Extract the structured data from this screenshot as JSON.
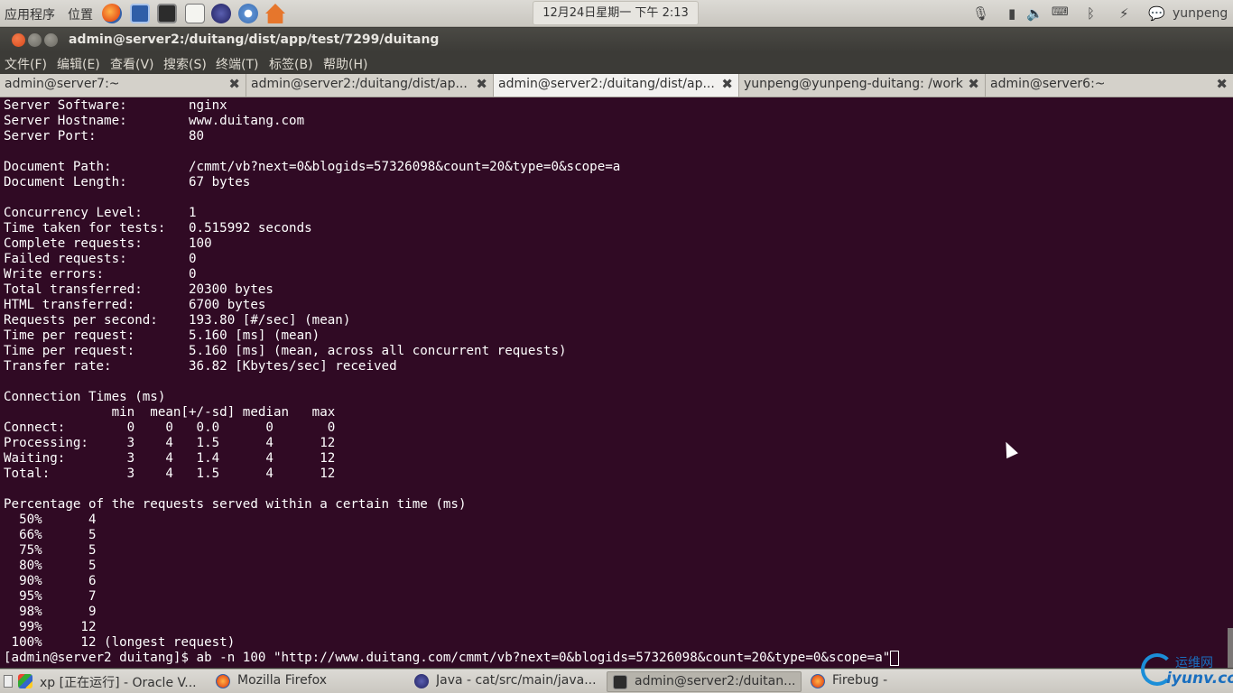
{
  "top_panel": {
    "menus": [
      "应用程序",
      "位置"
    ],
    "launchers": [
      "firefox-icon",
      "system-monitor-icon",
      "terminal-icon",
      "text-editor-icon",
      "eclipse-icon",
      "chromium-icon",
      "home-icon"
    ],
    "clock": "12月24日星期一 下午 2:13",
    "user": "yunpeng"
  },
  "window": {
    "title": "admin@server2:/duitang/dist/app/test/7299/duitang"
  },
  "menubar": [
    "文件(F)",
    "编辑(E)",
    "查看(V)",
    "搜索(S)",
    "终端(T)",
    "标签(B)",
    "帮助(H)"
  ],
  "tabs": [
    {
      "label": "admin@server7:~",
      "active": false
    },
    {
      "label": "admin@server2:/duitang/dist/ap...",
      "active": false
    },
    {
      "label": "admin@server2:/duitang/dist/ap...",
      "active": true
    },
    {
      "label": "yunpeng@yunpeng-duitang: /work",
      "active": false
    },
    {
      "label": "admin@server6:~",
      "active": false
    }
  ],
  "terminal_lines": [
    "Server Software:        nginx",
    "Server Hostname:        www.duitang.com",
    "Server Port:            80",
    "",
    "Document Path:          /cmmt/vb?next=0&blogids=57326098&count=20&type=0&scope=a",
    "Document Length:        67 bytes",
    "",
    "Concurrency Level:      1",
    "Time taken for tests:   0.515992 seconds",
    "Complete requests:      100",
    "Failed requests:        0",
    "Write errors:           0",
    "Total transferred:      20300 bytes",
    "HTML transferred:       6700 bytes",
    "Requests per second:    193.80 [#/sec] (mean)",
    "Time per request:       5.160 [ms] (mean)",
    "Time per request:       5.160 [ms] (mean, across all concurrent requests)",
    "Transfer rate:          36.82 [Kbytes/sec] received",
    "",
    "Connection Times (ms)",
    "              min  mean[+/-sd] median   max",
    "Connect:        0    0   0.0      0       0",
    "Processing:     3    4   1.5      4      12",
    "Waiting:        3    4   1.4      4      12",
    "Total:          3    4   1.5      4      12",
    "",
    "Percentage of the requests served within a certain time (ms)",
    "  50%      4",
    "  66%      5",
    "  75%      5",
    "  80%      5",
    "  90%      6",
    "  95%      7",
    "  98%      9",
    "  99%     12",
    " 100%     12 (longest request)",
    "[admin@server2 duitang]$ ab -n 100 \"http://www.duitang.com/cmmt/vb?next=0&blogids=57326098&count=20&type=0&scope=a\""
  ],
  "taskbar": [
    {
      "label": "xp [正在运行] - Oracle V...",
      "icon": "virtualbox-icon",
      "active": false
    },
    {
      "label": "Mozilla Firefox",
      "icon": "firefox-icon",
      "active": false
    },
    {
      "label": "Java - cat/src/main/java...",
      "icon": "eclipse-icon",
      "active": false
    },
    {
      "label": "admin@server2:/duitan...",
      "icon": "terminal-icon",
      "active": true
    },
    {
      "label": "Firebug -",
      "icon": "firefox-icon",
      "active": false
    }
  ],
  "watermark": {
    "top": "运维网",
    "bottom": "iyunv.com"
  },
  "colors": {
    "terminal_bg": "#300a24",
    "panel_bg": "#dcdad5",
    "titlebar_bg": "#3c3b37",
    "close_button": "#e95420"
  }
}
